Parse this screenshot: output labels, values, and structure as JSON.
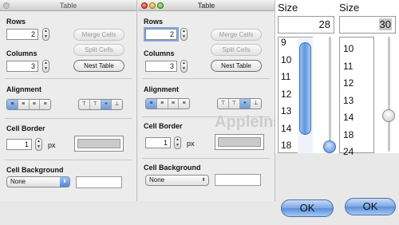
{
  "left_dialog": {
    "title": "Table",
    "rows_label": "Rows",
    "rows_value": "2",
    "columns_label": "Columns",
    "columns_value": "3",
    "merge_cells": "Merge Cells",
    "split_cells": "Split Cells",
    "nest_table": "Nest Table",
    "alignment_label": "Alignment",
    "cell_border_label": "Cell Border",
    "border_value": "1",
    "border_unit": "px",
    "cell_background_label": "Cell Background",
    "background_option": "None"
  },
  "right_dialog": {
    "title": "Table",
    "rows_label": "Rows",
    "rows_value": "2",
    "columns_label": "Columns",
    "columns_value": "3",
    "merge_cells": "Merge Cells",
    "split_cells": "Split Cells",
    "nest_table": "Nest Table",
    "alignment_label": "Alignment",
    "cell_border_label": "Cell Border",
    "border_value": "1",
    "border_unit": "px",
    "cell_background_label": "Cell Background",
    "background_option": "None"
  },
  "watermark": "AppleInsider",
  "size_panel_left": {
    "heading": "Size",
    "value": "28",
    "options": [
      "9",
      "10",
      "11",
      "12",
      "13",
      "14",
      "18"
    ],
    "ok_label": "OK"
  },
  "size_panel_right": {
    "heading": "Size",
    "value": "30",
    "options": [
      "10",
      "11",
      "12",
      "13",
      "14",
      "18",
      "24"
    ],
    "ok_label": "OK"
  }
}
